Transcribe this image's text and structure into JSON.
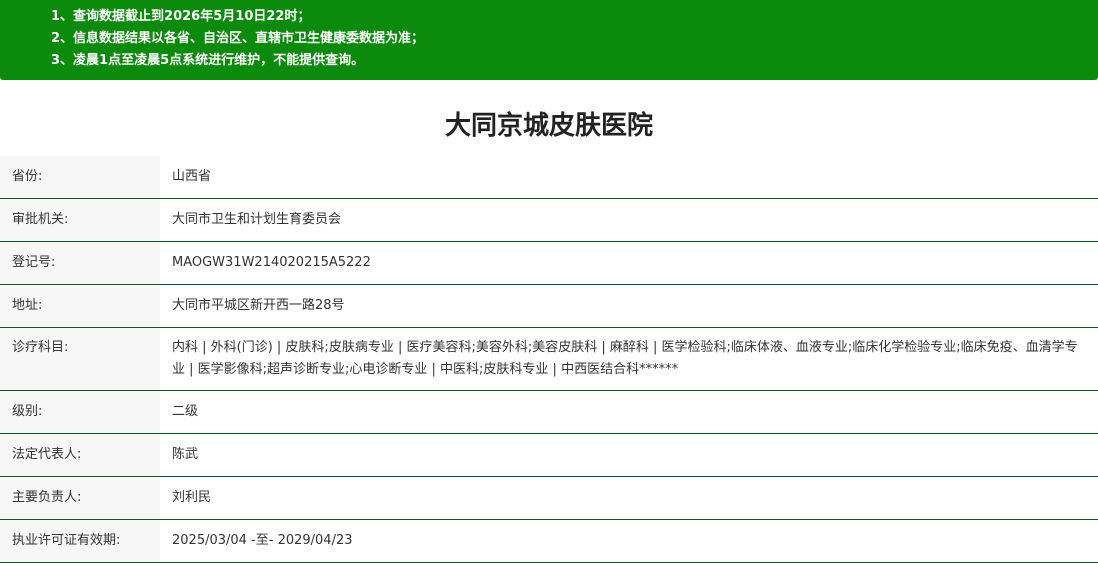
{
  "notice": {
    "lines": [
      "1、查询数据截止到2026年5月10日22时；",
      "2、信息数据结果以各省、自治区、直辖市卫生健康委数据为准；",
      "3、凌晨1点至凌晨5点系统进行维护，不能提供查询。"
    ]
  },
  "hospital": {
    "name": "大同京城皮肤医院"
  },
  "fields": [
    {
      "label": "省份:",
      "value": "山西省"
    },
    {
      "label": "审批机关:",
      "value": "大同市卫生和计划生育委员会"
    },
    {
      "label": "登记号:",
      "value": "MAOGW31W214020215A5222"
    },
    {
      "label": "地址:",
      "value": "大同市平城区新开西一路28号"
    },
    {
      "label": "诊疗科目:",
      "value": "内科 | 外科(门诊) | 皮肤科;皮肤病专业 | 医疗美容科;美容外科;美容皮肤科 | 麻醉科 | 医学检验科;临床体液、血液专业;临床化学检验专业;临床免疫、血清学专业 | 医学影像科;超声诊断专业;心电诊断专业 | 中医科;皮肤科专业 | 中西医结合科******"
    },
    {
      "label": "级别:",
      "value": "二级"
    },
    {
      "label": "法定代表人:",
      "value": "陈武"
    },
    {
      "label": "主要负责人:",
      "value": "刘利民"
    },
    {
      "label": "执业许可证有效期:",
      "value": "2025/03/04 -至- 2029/04/23"
    }
  ],
  "colors": {
    "notice_bg": "#0b8a0b",
    "row_border": "#0b5a2a",
    "label_bg": "#f7f7f7"
  }
}
